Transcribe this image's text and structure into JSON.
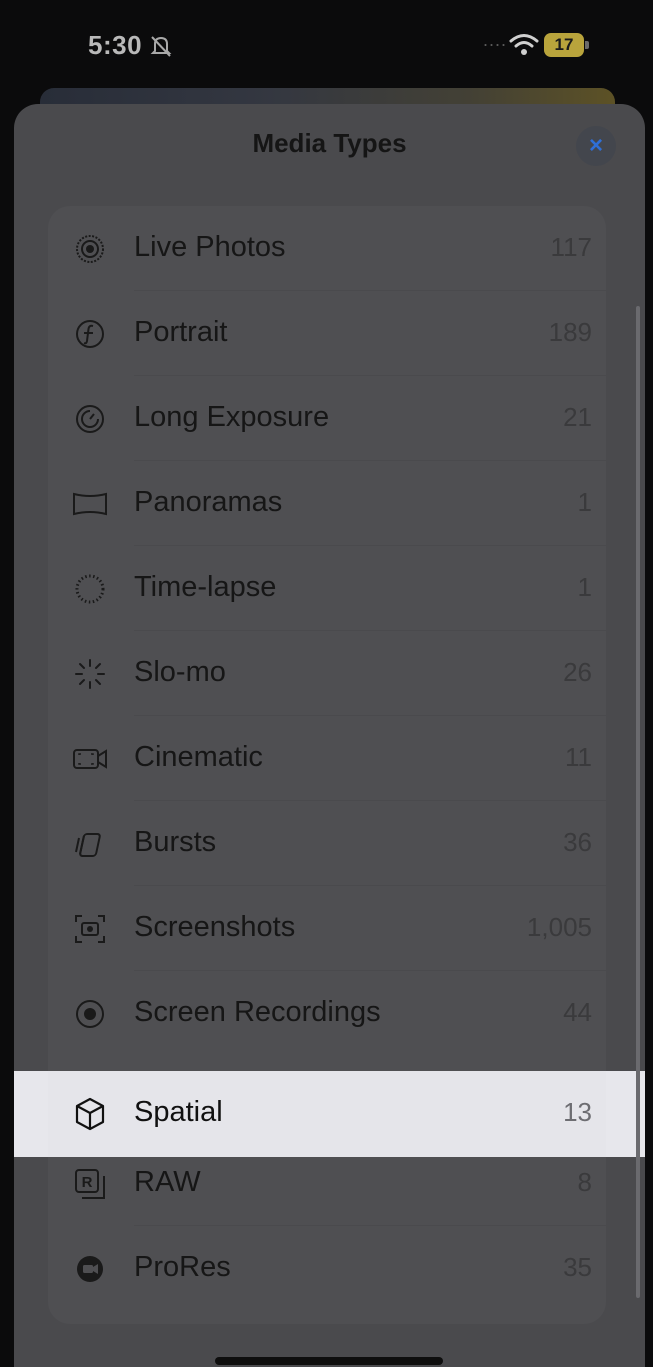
{
  "status_bar": {
    "time": "5:30",
    "signal_dots": "....",
    "battery": "17"
  },
  "sheet": {
    "title": "Media Types",
    "close_label": "×"
  },
  "rows": [
    {
      "label": "Live Photos",
      "count": "117",
      "icon": "live-photos-icon"
    },
    {
      "label": "Portrait",
      "count": "189",
      "icon": "portrait-icon"
    },
    {
      "label": "Long Exposure",
      "count": "21",
      "icon": "long-exposure-icon"
    },
    {
      "label": "Panoramas",
      "count": "1",
      "icon": "panorama-icon"
    },
    {
      "label": "Time-lapse",
      "count": "1",
      "icon": "time-lapse-icon"
    },
    {
      "label": "Slo-mo",
      "count": "26",
      "icon": "slo-mo-icon"
    },
    {
      "label": "Cinematic",
      "count": "11",
      "icon": "cinematic-icon"
    },
    {
      "label": "Bursts",
      "count": "36",
      "icon": "bursts-icon"
    },
    {
      "label": "Screenshots",
      "count": "1,005",
      "icon": "screenshot-icon"
    },
    {
      "label": "Screen Recordings",
      "count": "44",
      "icon": "screen-recording-icon"
    },
    {
      "label": "Spatial",
      "count": "13",
      "icon": "spatial-icon"
    },
    {
      "label": "RAW",
      "count": "8",
      "icon": "raw-icon"
    },
    {
      "label": "ProRes",
      "count": "35",
      "icon": "prores-icon"
    }
  ],
  "colors": {
    "accent": "#2f6fd6",
    "highlight": "#e7e7ec",
    "battery": "#b9a43c"
  }
}
